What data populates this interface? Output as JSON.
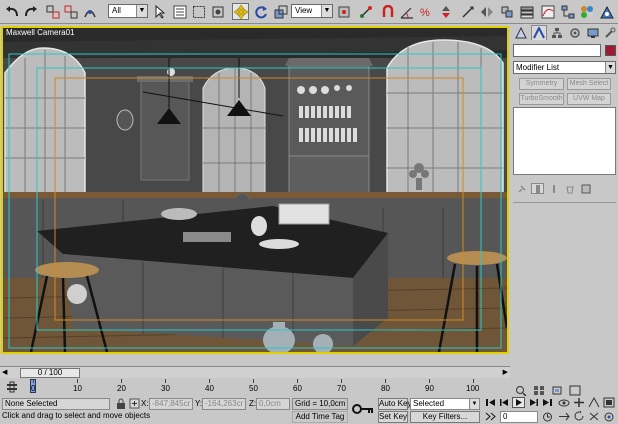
{
  "toolbar": {
    "filter_value": "All",
    "refcoord_value": "View"
  },
  "viewport": {
    "label": "Maxwell Camera01"
  },
  "command_panel": {
    "modifier_list": "Modifier List",
    "buttons": [
      "Symmetry",
      "Mesh Select",
      "TurboSmooth",
      "UVW Map"
    ]
  },
  "timeline": {
    "position": "0 / 100",
    "ticks": [
      "0",
      "10",
      "20",
      "30",
      "40",
      "50",
      "60",
      "70",
      "80",
      "90",
      "100"
    ]
  },
  "status": {
    "selection": "None Selected",
    "prompt": "Click and drag to select and move objects",
    "x_value": "-847,845cr",
    "y_value": "-164,263cr",
    "z_value": "0,0cm",
    "grid": "Grid = 10,0cm",
    "add_time_tag": "Add Time Tag",
    "auto_key": "Auto Key",
    "selected_value": "Selected",
    "set_key": "Set Key",
    "key_filters": "Key Filters...",
    "frame": "0",
    "x_label": "X:",
    "y_label": "Y:",
    "z_label": "Z:"
  },
  "colors": {
    "active_viewport_border": "#e0d000",
    "object_color": "#a01a36",
    "safe_frame_cyan": "#2ac8c8",
    "safe_frame_orange": "#d08a20"
  }
}
